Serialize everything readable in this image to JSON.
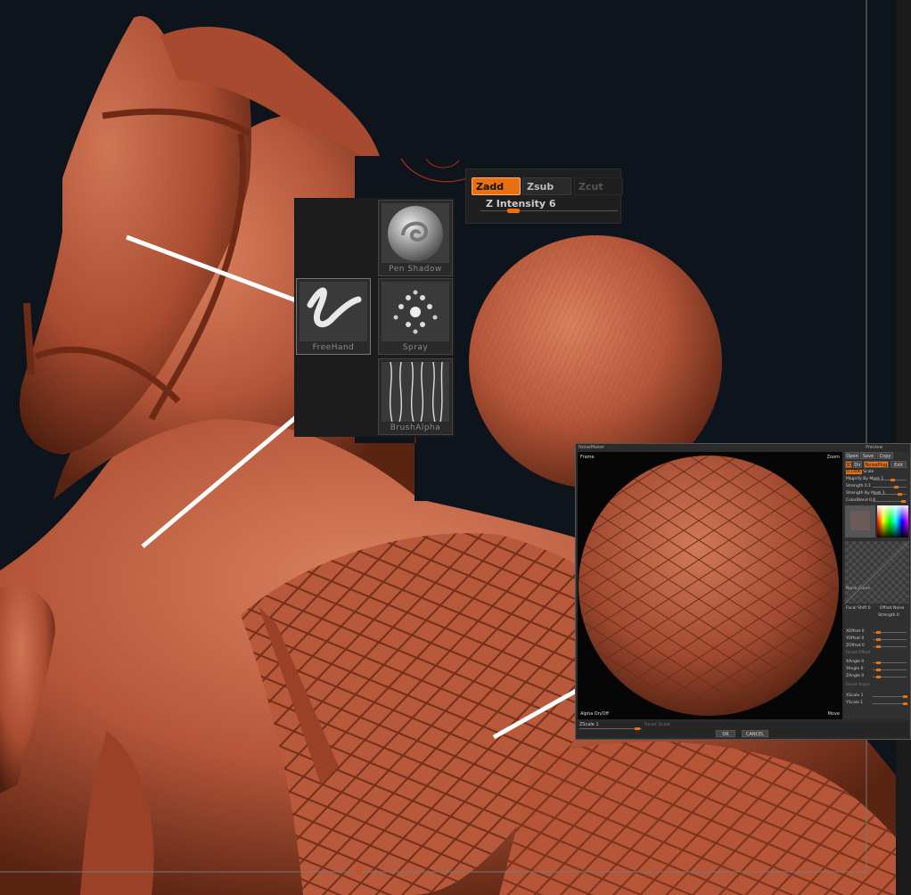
{
  "brush_palette": {
    "items": [
      {
        "label": "Pen Shadow"
      },
      {
        "label": "FreeHand"
      },
      {
        "label": "Spray"
      },
      {
        "label": "BrushAlpha"
      }
    ]
  },
  "z_toggle": {
    "zadd": "Zadd",
    "zsub": "Zsub",
    "zcut": "Zcut",
    "intensity_label": "Z Intensity 6",
    "intensity_value": 6
  },
  "noise_maker": {
    "title": "NoiseMaker",
    "preview_title": "Preview",
    "frame_label": "Frame",
    "zoom_label": "Zoom",
    "move_label": "Move",
    "alpha_toggle": "Alpha On/Off",
    "zscale_label": "ZScale 1",
    "reset_scale": "Reset Scale",
    "top_buttons": [
      "Open",
      "Save",
      "Copy"
    ],
    "row_buttons": [
      "3D",
      "Dir",
      "NoisePlug",
      "Edit"
    ],
    "scale_label": "Scale",
    "scale_value": "0.1406",
    "noise_curve_label": "Noise Curve",
    "params": [
      "Magnify By Mask 1",
      "Strength 0.1",
      "Strength By Mask 1",
      "ColorBlend 0.6"
    ],
    "focal_row": [
      "Focal Shift 0",
      "Offset Noise"
    ],
    "strength_row": "Strength 0",
    "offsets": [
      "XOffset 0",
      "YOffset 0",
      "ZOffset 0"
    ],
    "reset_offset": "Reset Offset",
    "angles": [
      "XAngle 0",
      "YAngle 0",
      "ZAngle 0"
    ],
    "reset_angle": "Reset Angle",
    "scales": [
      "XScale 1",
      "YScale 1"
    ],
    "ok": "OK",
    "cancel": "CANCEL"
  },
  "colors": {
    "background": "#0d141b",
    "clay": "#b5563a",
    "accent_orange": "#e8700e",
    "panel": "#1c1c1c"
  }
}
